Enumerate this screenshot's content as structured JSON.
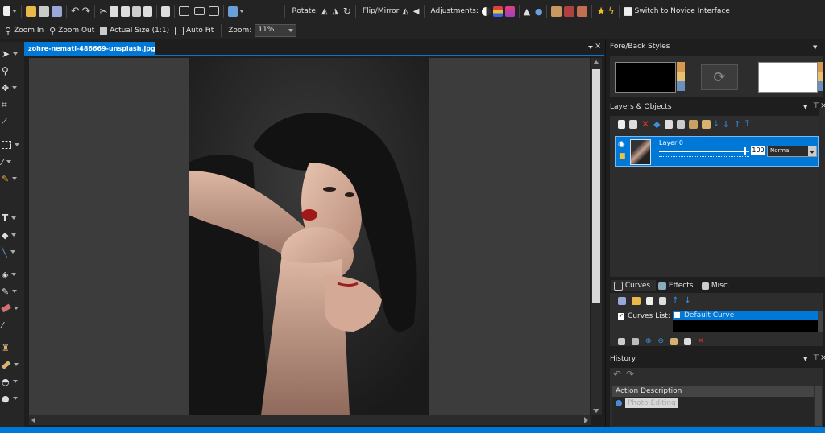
{
  "toolbar": {
    "rotate_label": "Rotate:",
    "flip_label": "Flip/Mirror",
    "adjust_label": "Adjustments:",
    "novice_label": "Switch to Novice Interface"
  },
  "zoombar": {
    "zoom_in": "Zoom In",
    "zoom_out": "Zoom Out",
    "actual_size": "Actual Size (1:1)",
    "auto_fit": "Auto Fit",
    "zoom_label": "Zoom:",
    "zoom_value": "11%"
  },
  "document": {
    "tab_title": "zohre-nemati-486669-unsplash.jpg"
  },
  "fore_back": {
    "title": "Fore/Back Styles",
    "fore_color": "#000000",
    "back_color": "#ffffff"
  },
  "layers": {
    "title": "Layers & Objects",
    "layer_name": "Layer 0",
    "opacity": "100",
    "opacity_fraction": 0.95,
    "blend_mode": "Normal"
  },
  "curves": {
    "tabs": [
      "Curves",
      "Effects",
      "Misc."
    ],
    "list_label": "Curves List:",
    "selected_item": "Default Curve"
  },
  "history": {
    "title": "History",
    "column_header": "Action Description",
    "entry": "Photo Editing"
  },
  "colors": {
    "accent": "#0078d7",
    "panel": "#2d2d2d",
    "canvas": "#3c3c3c"
  }
}
